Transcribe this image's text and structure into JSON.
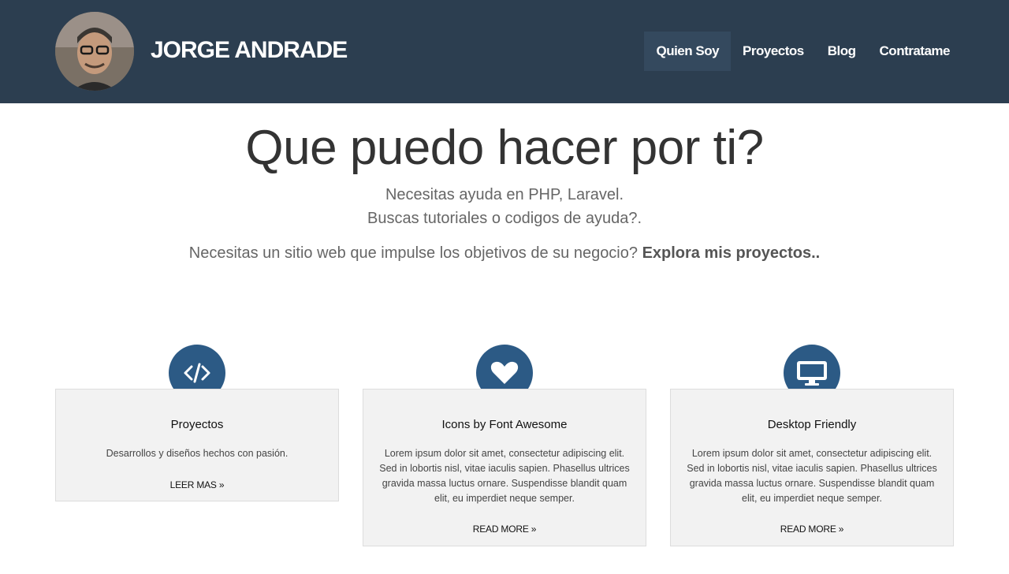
{
  "header": {
    "brand": "JORGE ANDRADE",
    "nav": [
      "Quien Soy",
      "Proyectos",
      "Blog",
      "Contratame"
    ],
    "active_nav": "Quien Soy"
  },
  "intro": {
    "title": "Que puedo hacer por ti?",
    "line1": "Necesitas ayuda en PHP, Laravel.",
    "line2": "Buscas tutoriales o codigos de ayuda?.",
    "cta_text": "Necesitas un sitio web que impulse los objetivos de su negocio?",
    "cta_link": "Explora mis proyectos.."
  },
  "features": [
    {
      "icon": "code-icon",
      "title": "Proyectos",
      "text": "Desarrollos y diseños hechos con pasión.",
      "link": "LEER MAS »"
    },
    {
      "icon": "heart-icon",
      "title": "Icons by Font Awesome",
      "text": "Lorem ipsum dolor sit amet, consectetur adipiscing elit. Sed in lobortis nisl, vitae iaculis sapien. Phasellus ultrices gravida massa luctus ornare. Suspendisse blandit quam elit, eu imperdiet neque semper.",
      "link": "READ MORE »"
    },
    {
      "icon": "desktop-icon",
      "title": "Desktop Friendly",
      "text": "Lorem ipsum dolor sit amet, consectetur adipiscing elit. Sed in lobortis nisl, vitae iaculis sapien. Phasellus ultrices gravida massa luctus ornare. Suspendisse blandit quam elit, eu imperdiet neque semper.",
      "link": "READ MORE »"
    }
  ],
  "colors": {
    "header_bg": "#2c3e50",
    "nav_active_bg": "#34495e",
    "icon_circle": "#2c5a85",
    "box_bg": "#f2f2f2"
  }
}
